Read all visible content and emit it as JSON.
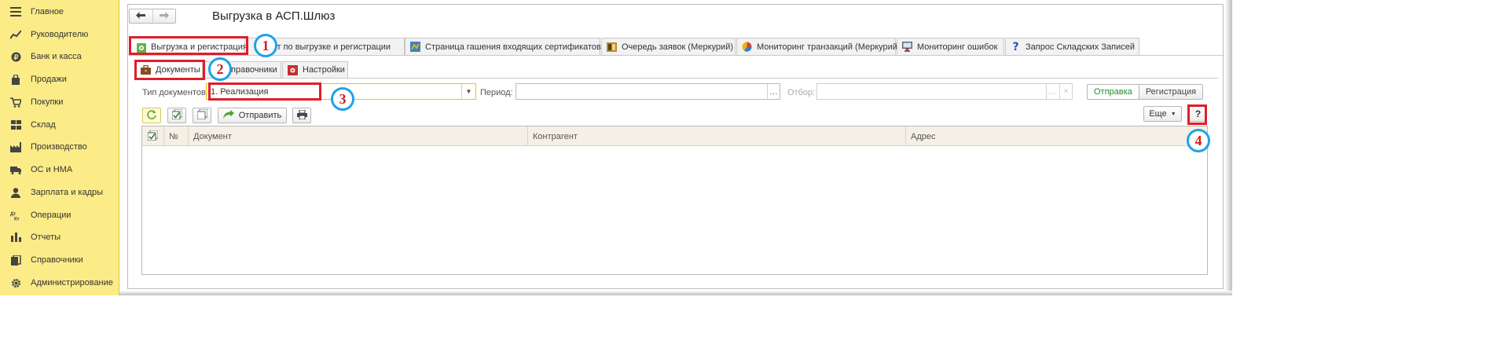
{
  "sidebar": {
    "items": [
      {
        "label": "Главное",
        "icon": "menu-lines-icon"
      },
      {
        "label": "Руководителю",
        "icon": "chart-line-icon"
      },
      {
        "label": "Банк и касса",
        "icon": "coin-icon"
      },
      {
        "label": "Продажи",
        "icon": "shopping-bag-icon"
      },
      {
        "label": "Покупки",
        "icon": "cart-icon"
      },
      {
        "label": "Склад",
        "icon": "warehouse-grid-icon"
      },
      {
        "label": "Производство",
        "icon": "factory-icon"
      },
      {
        "label": "ОС и НМА",
        "icon": "truck-icon"
      },
      {
        "label": "Зарплата и кадры",
        "icon": "person-icon"
      },
      {
        "label": "Операции",
        "icon": "dt-kt-icon"
      },
      {
        "label": "Отчеты",
        "icon": "bar-chart-icon"
      },
      {
        "label": "Справочники",
        "icon": "books-icon"
      },
      {
        "label": "Администрирование",
        "icon": "gear-icon"
      }
    ]
  },
  "window": {
    "title": "Выгрузка в АСП.Шлюз"
  },
  "tabs": [
    {
      "label": "Выгрузка и регистрация",
      "icon": "upload-doc-icon"
    },
    {
      "label": "чет по выгрузке и регистрации",
      "icon": "report-icon"
    },
    {
      "label": "Страница гашения входящих сертификатов",
      "icon": "certificate-icon"
    },
    {
      "label": "Очередь заявок (Меркурий)",
      "icon": "queue-icon"
    },
    {
      "label": "Мониторинг транзакций (Меркурий)",
      "icon": "pie-chart-icon"
    },
    {
      "label": "Мониторинг ошибок",
      "icon": "monitor-icon"
    },
    {
      "label": "Запрос Складских Записей",
      "icon": "question-icon"
    }
  ],
  "subtabs": [
    {
      "label": "Документы",
      "icon": "briefcase-icon"
    },
    {
      "label": "правочники",
      "icon": "books-icon"
    },
    {
      "label": "Настройки",
      "icon": "settings-icon"
    }
  ],
  "filters": {
    "doc_type_label": "Тип документов:",
    "doc_type_value": "1. Реализация",
    "period_label": "Период:",
    "period_value": "",
    "filter_label": "Отбор:",
    "filter_value": ""
  },
  "mode": {
    "send": "Отправка",
    "register": "Регистрация"
  },
  "toolbar": {
    "send_label": "Отправить",
    "more_label": "Еще",
    "help_label": "?"
  },
  "table": {
    "columns": [
      "№",
      "Документ",
      "Контрагент",
      "Адрес"
    ],
    "rows": []
  },
  "annotations": [
    "1",
    "2",
    "3",
    "4"
  ],
  "colors": {
    "sidebar_bg": "#fbec88",
    "accent_red": "#e11d2a",
    "callout_blue": "#1ea2e8",
    "send_green": "#1d8a2f"
  }
}
